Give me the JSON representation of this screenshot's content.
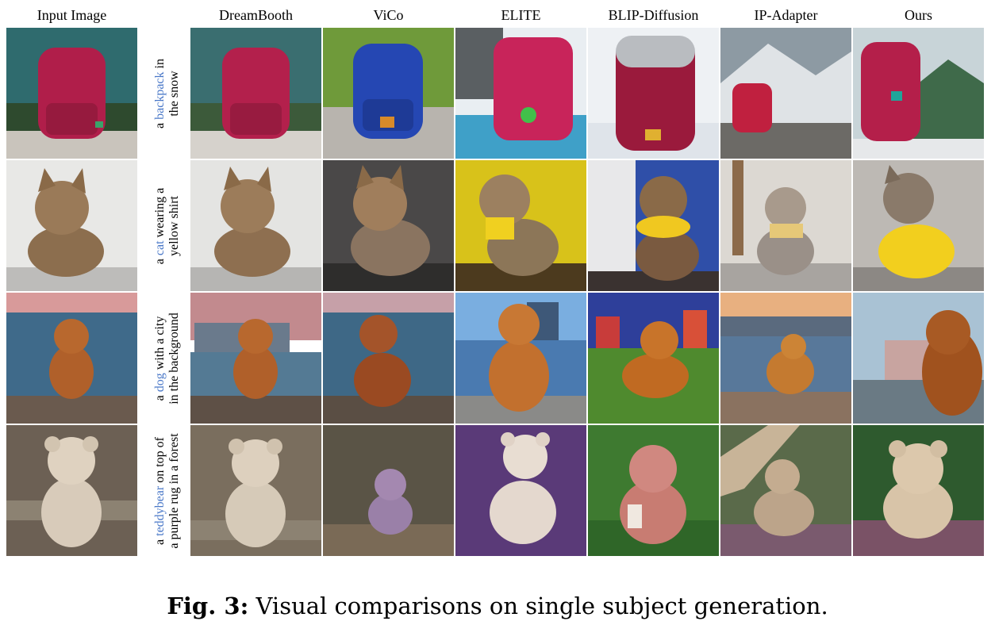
{
  "headers": {
    "input": "Input Image",
    "methods": [
      "DreamBooth",
      "ViCo",
      "ELITE",
      "BLIP-Diffusion",
      "IP-Adapter",
      "Ours"
    ]
  },
  "rows": [
    {
      "prompt": {
        "l1a": "a ",
        "kw": "backpack",
        "l1b": " in",
        "l2": "the snow"
      }
    },
    {
      "prompt": {
        "l1a": "a ",
        "kw": "cat",
        "l1b": " wearing a",
        "l2": "yellow shirt"
      }
    },
    {
      "prompt": {
        "l1a": "a ",
        "kw": "dog",
        "l1b": " with a city",
        "l2": "in the background"
      }
    },
    {
      "prompt": {
        "l1a": "a ",
        "kw": "teddybear",
        "l1b": " on top of",
        "l2": "a purple rug in a forest"
      }
    }
  ],
  "caption": {
    "label": "Fig. 3:",
    "text": " Visual comparisons on single subject generation."
  }
}
